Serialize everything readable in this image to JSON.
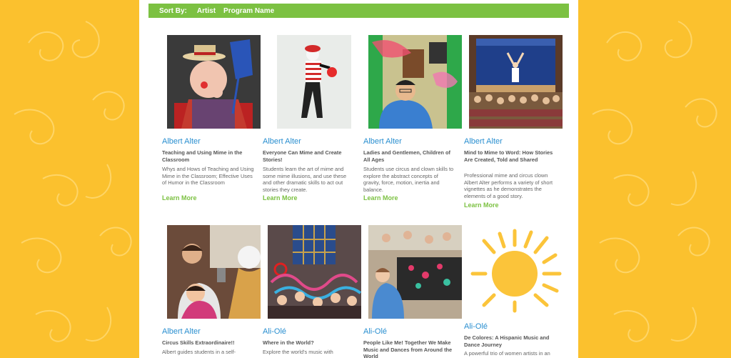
{
  "sort": {
    "label": "Sort By:",
    "options": [
      "Artist",
      "Program Name"
    ]
  },
  "colors": {
    "background": "#fbc12e",
    "accent_green": "#7cc142",
    "link_blue": "#2a8fd0"
  },
  "programs": [
    {
      "artist": "Albert Alter",
      "title": "Teaching and Using Mime in the Classroom",
      "description": "Whys and Hows of Teaching and Using Mime in the Classroom; Effective Uses of Humor in the Classroom",
      "more": "Learn More",
      "image": "clown-with-flyswatter-photo"
    },
    {
      "artist": "Albert Alter",
      "title": "Everyone Can Mime and Create Stories!",
      "description": "Students learn the art of mime and some mime illusions, and use these and other dramatic skills to act out stories they create.",
      "more": "Learn More",
      "image": "mime-with-balloon-photo"
    },
    {
      "artist": "Albert Alter",
      "title": "Ladies and Gentlemen, Children of All Ages",
      "description": "Students use circus and clown skills to explore the abstract concepts of gravity, force, motion, inertia and balance.",
      "more": "Learn More",
      "image": "student-juggling-scarves-photo"
    },
    {
      "artist": "Albert Alter",
      "title": "Mind to Mime to Word: How Stories Are Created, Told and Shared",
      "description": "Professional mime and circus clown Albert Alter performs a variety of short vignettes as he demonstrates the elements of a good story.",
      "more": "Learn More",
      "image": "auditorium-performance-photo"
    },
    {
      "artist": "Albert Alter",
      "title": "Circus Skills Extraordinaire!!",
      "description": "Albert guides students in a self-",
      "image": "clown-with-children-photo"
    },
    {
      "artist": "Ali-Olé",
      "title": "Where in the World?",
      "description": "Explore the world's music with",
      "image": "children-with-ribbons-photo"
    },
    {
      "artist": "Ali-Olé",
      "title": "People Like Me! Together We Make Music and Dances from Around the World",
      "description": "",
      "image": "children-making-crafts-photo"
    },
    {
      "artist": "Ali-Olé",
      "title": "De Colores: A Hispanic Music and Dance Journey",
      "description": "A powerful trio of women artists in an",
      "image": "sun-drawing"
    }
  ]
}
